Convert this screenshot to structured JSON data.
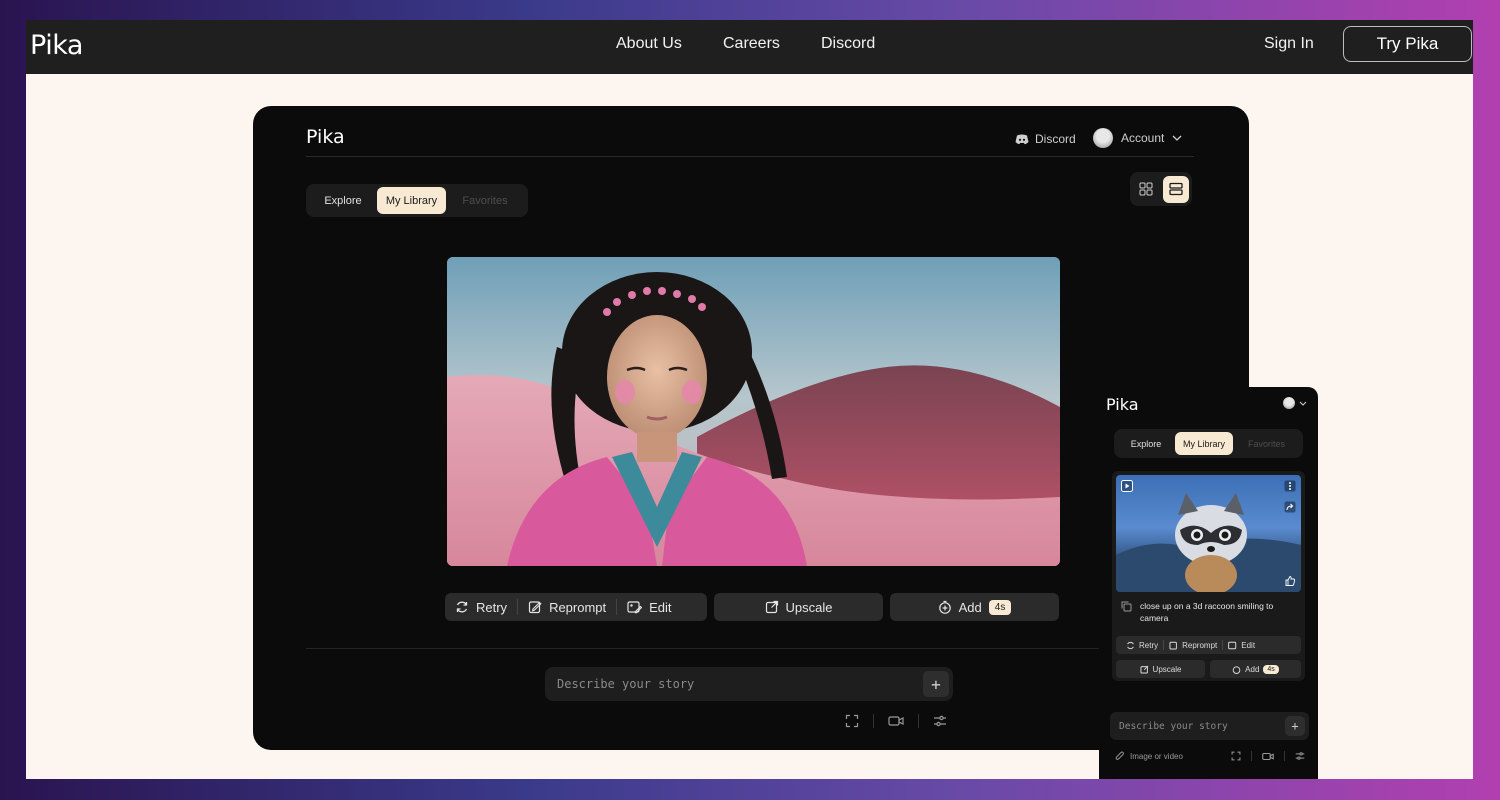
{
  "site": {
    "logo": "Pika",
    "nav": [
      "About Us",
      "Careers",
      "Discord"
    ],
    "sign_in": "Sign In",
    "cta": "Try Pika"
  },
  "app": {
    "logo": "Pika",
    "discord": "Discord",
    "account": "Account",
    "tabs": [
      "Explore",
      "My Library",
      "Favorites"
    ],
    "active_tab": "My Library",
    "view_modes": [
      "grid",
      "list"
    ],
    "active_view": "list",
    "actions": {
      "retry": "Retry",
      "reprompt": "Reprompt",
      "edit": "Edit",
      "upscale": "Upscale",
      "add": "Add",
      "add_duration": "4s"
    },
    "prompt_placeholder": "Describe your story"
  },
  "mobile": {
    "logo": "Pika",
    "tabs": [
      "Explore",
      "My Library",
      "Favorites"
    ],
    "caption": "close up on a 3d raccoon smiling to camera",
    "actions": {
      "retry": "Retry",
      "reprompt": "Reprompt",
      "edit": "Edit",
      "upscale": "Upscale",
      "add": "Add",
      "add_duration": "4s"
    },
    "prompt_placeholder": "Describe your story",
    "attach_label": "Image or video"
  },
  "colors": {
    "accent": "#f7e9d2",
    "panel": "#0b0b0b",
    "nav_bg": "#1f1f1f",
    "page_bg": "#fcf5f0"
  }
}
